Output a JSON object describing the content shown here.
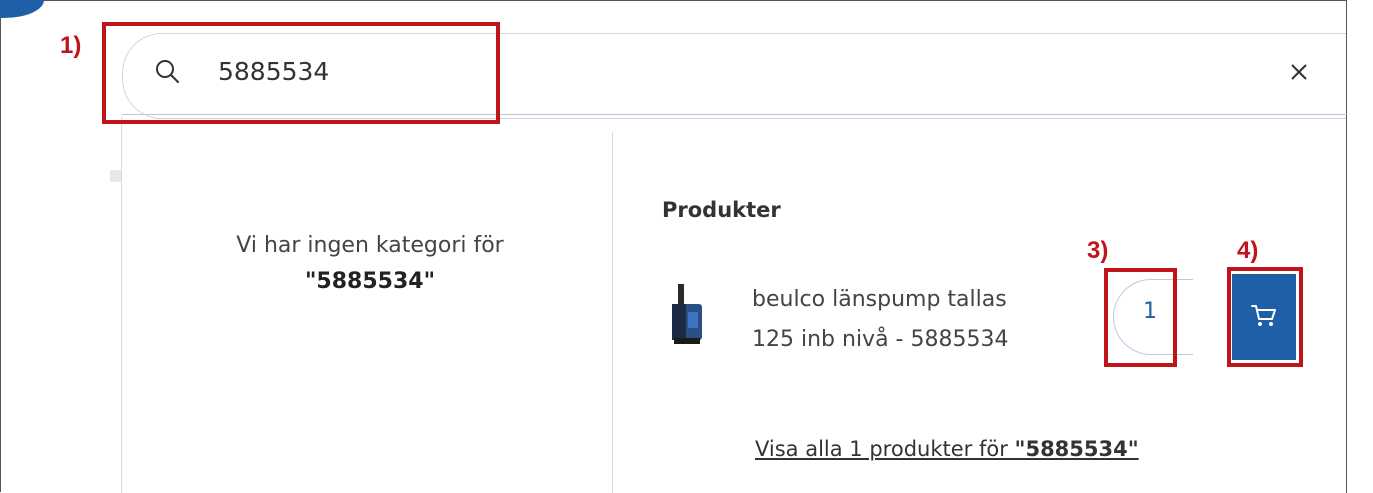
{
  "search": {
    "value": "5885534"
  },
  "categories": {
    "no_result_text": "Vi har ingen kategori för",
    "no_result_term": "\"5885534\""
  },
  "products": {
    "heading": "Produkter",
    "items": [
      {
        "name_line1": "beulco länspump tallas",
        "name_line2": "125 inb nivå - 5885534",
        "quantity": "1"
      }
    ],
    "show_all_text": "Visa alla 1 produkter för ",
    "show_all_term": "\"5885534\""
  },
  "annotations": [
    {
      "label": "1)"
    },
    {
      "label": "3)"
    },
    {
      "label": "4)"
    }
  ],
  "icons": {
    "search": "search-icon",
    "clear": "close-icon",
    "cart": "cart-icon",
    "product": "product-thumbnail"
  },
  "colors": {
    "accent": "#1f5fa8",
    "annotation": "#c0141b"
  }
}
